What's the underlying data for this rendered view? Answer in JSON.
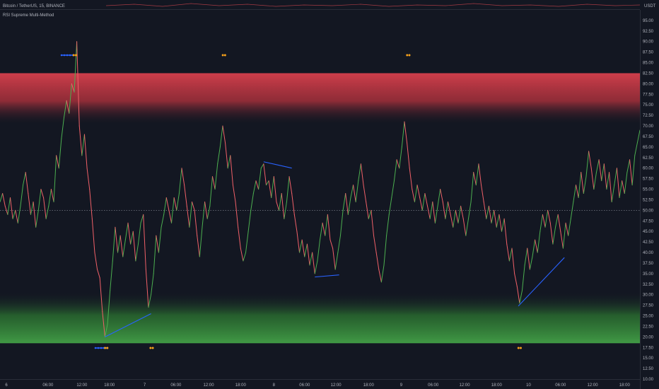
{
  "header": {
    "symbol_label": "Bitcoin / TetherUS, 15, BINANCE",
    "currency": "USDT"
  },
  "indicator": {
    "name": "RSI Supreme Multi-Method"
  },
  "colors": {
    "background": "#131722",
    "overbought_zone": "#c9434c",
    "oversold_zone": "#3a9a45",
    "divergence_line": "#2962ff",
    "signal_marker": "#f7a21b",
    "rsi_up": "#4caf50",
    "rsi_down": "#f06068"
  },
  "chart_data": {
    "type": "line",
    "title": "",
    "ylim": [
      10.0,
      97.5
    ],
    "yticks": [
      95.0,
      92.5,
      90.0,
      87.5,
      85.0,
      82.5,
      80.0,
      77.5,
      75.0,
      72.5,
      70.0,
      67.5,
      65.0,
      62.5,
      60.0,
      57.5,
      55.0,
      52.5,
      50.0,
      47.5,
      45.0,
      42.5,
      40.0,
      37.5,
      35.0,
      32.5,
      30.0,
      27.5,
      25.0,
      22.5,
      20.0,
      17.5,
      15.0,
      12.5,
      10.0
    ],
    "ytick_labels": [
      "95.00",
      "92.50",
      "90.00",
      "87.50",
      "85.00",
      "82.50",
      "80.00",
      "77.50",
      "75.00",
      "72.50",
      "70.00",
      "67.50",
      "65.00",
      "62.50",
      "60.00",
      "57.50",
      "55.00",
      "52.50",
      "50.00",
      "47.50",
      "45.00",
      "42.50",
      "40.00",
      "37.50",
      "35.00",
      "32.50",
      "30.00",
      "27.50",
      "25.00",
      "22.50",
      "20.00",
      "17.50",
      "15.00",
      "12.50",
      "10.00"
    ],
    "xlim": [
      0,
      100
    ],
    "xticks": [
      {
        "x": 1.0,
        "label": "6"
      },
      {
        "x": 7.5,
        "label": "06:00"
      },
      {
        "x": 12.8,
        "label": "12:00"
      },
      {
        "x": 17.1,
        "label": "18:00"
      },
      {
        "x": 22.6,
        "label": "7"
      },
      {
        "x": 27.5,
        "label": "06:00"
      },
      {
        "x": 32.6,
        "label": "12:00"
      },
      {
        "x": 37.6,
        "label": "18:00"
      },
      {
        "x": 42.8,
        "label": "8"
      },
      {
        "x": 47.6,
        "label": "06:00"
      },
      {
        "x": 52.5,
        "label": "12:00"
      },
      {
        "x": 57.6,
        "label": "18:00"
      },
      {
        "x": 62.7,
        "label": "9"
      },
      {
        "x": 67.7,
        "label": "06:00"
      },
      {
        "x": 72.6,
        "label": "12:00"
      },
      {
        "x": 77.6,
        "label": "18:00"
      },
      {
        "x": 82.6,
        "label": "10"
      },
      {
        "x": 87.6,
        "label": "06:00"
      },
      {
        "x": 92.6,
        "label": "12:00"
      },
      {
        "x": 97.6,
        "label": "18:00"
      }
    ],
    "overbought_band": [
      70.5,
      82.5
    ],
    "oversold_band": [
      18.5,
      30.5
    ],
    "midline": 50,
    "series": [
      {
        "points": [
          [
            0,
            52
          ],
          [
            0.4,
            54
          ],
          [
            0.8,
            51
          ],
          [
            1.2,
            49
          ],
          [
            1.6,
            53
          ],
          [
            2.0,
            48
          ],
          [
            2.4,
            50
          ],
          [
            2.8,
            47
          ],
          [
            3.2,
            51
          ],
          [
            3.6,
            56
          ],
          [
            4.0,
            59
          ],
          [
            4.4,
            54
          ],
          [
            4.8,
            49
          ],
          [
            5.2,
            52
          ],
          [
            5.6,
            46
          ],
          [
            6.0,
            50
          ],
          [
            6.4,
            55
          ],
          [
            6.8,
            53
          ],
          [
            7.2,
            48
          ],
          [
            7.6,
            51
          ],
          [
            8.0,
            55
          ],
          [
            8.4,
            52
          ],
          [
            8.8,
            63
          ],
          [
            9.2,
            60
          ],
          [
            9.6,
            67
          ],
          [
            10.0,
            72
          ],
          [
            10.4,
            76
          ],
          [
            10.8,
            73
          ],
          [
            11.2,
            80
          ],
          [
            11.6,
            78
          ],
          [
            12.0,
            90
          ],
          [
            12.4,
            70
          ],
          [
            12.8,
            63
          ],
          [
            13.2,
            68
          ],
          [
            13.6,
            60
          ],
          [
            14.0,
            55
          ],
          [
            14.4,
            48
          ],
          [
            14.8,
            40
          ],
          [
            15.2,
            36
          ],
          [
            15.6,
            34
          ],
          [
            16.0,
            26
          ],
          [
            16.4,
            20
          ],
          [
            16.8,
            23
          ],
          [
            17.2,
            31
          ],
          [
            17.6,
            38
          ],
          [
            18.0,
            46
          ],
          [
            18.4,
            40
          ],
          [
            18.8,
            44
          ],
          [
            19.2,
            39
          ],
          [
            19.6,
            43
          ],
          [
            20.0,
            47
          ],
          [
            20.4,
            42
          ],
          [
            20.8,
            45
          ],
          [
            21.2,
            38
          ],
          [
            21.6,
            42
          ],
          [
            22.0,
            47
          ],
          [
            22.4,
            49
          ],
          [
            22.8,
            36
          ],
          [
            23.2,
            27
          ],
          [
            23.6,
            30
          ],
          [
            24.0,
            35
          ],
          [
            24.4,
            44
          ],
          [
            24.8,
            40
          ],
          [
            25.2,
            46
          ],
          [
            25.6,
            49
          ],
          [
            26.0,
            53
          ],
          [
            26.4,
            50
          ],
          [
            26.8,
            47
          ],
          [
            27.2,
            53
          ],
          [
            27.6,
            50
          ],
          [
            28.0,
            54
          ],
          [
            28.4,
            60
          ],
          [
            28.8,
            56
          ],
          [
            29.2,
            51
          ],
          [
            29.6,
            46
          ],
          [
            30.0,
            52
          ],
          [
            30.4,
            50
          ],
          [
            30.8,
            44
          ],
          [
            31.2,
            39
          ],
          [
            31.6,
            46
          ],
          [
            32.0,
            52
          ],
          [
            32.4,
            48
          ],
          [
            32.8,
            51
          ],
          [
            33.2,
            58
          ],
          [
            33.6,
            55
          ],
          [
            34.0,
            61
          ],
          [
            34.4,
            65
          ],
          [
            34.8,
            70
          ],
          [
            35.2,
            66
          ],
          [
            35.6,
            60
          ],
          [
            36.0,
            63
          ],
          [
            36.4,
            56
          ],
          [
            36.8,
            52
          ],
          [
            37.2,
            46
          ],
          [
            37.6,
            41
          ],
          [
            38.0,
            38
          ],
          [
            38.4,
            40
          ],
          [
            38.8,
            45
          ],
          [
            39.2,
            50
          ],
          [
            39.6,
            54
          ],
          [
            40.0,
            57
          ],
          [
            40.4,
            55
          ],
          [
            40.8,
            60
          ],
          [
            41.2,
            61
          ],
          [
            41.6,
            56
          ],
          [
            42.0,
            57
          ],
          [
            42.4,
            53
          ],
          [
            42.8,
            58
          ],
          [
            43.2,
            52
          ],
          [
            43.6,
            50
          ],
          [
            44.0,
            54
          ],
          [
            44.4,
            48
          ],
          [
            44.8,
            52
          ],
          [
            45.2,
            58
          ],
          [
            45.6,
            54
          ],
          [
            46.0,
            49
          ],
          [
            46.4,
            45
          ],
          [
            46.8,
            40
          ],
          [
            47.2,
            43
          ],
          [
            47.6,
            39
          ],
          [
            48.0,
            42
          ],
          [
            48.4,
            37
          ],
          [
            48.8,
            40
          ],
          [
            49.2,
            35
          ],
          [
            49.6,
            38
          ],
          [
            50.0,
            43
          ],
          [
            50.4,
            47
          ],
          [
            50.8,
            44
          ],
          [
            51.2,
            49
          ],
          [
            51.6,
            43
          ],
          [
            52.0,
            41
          ],
          [
            52.4,
            36
          ],
          [
            52.8,
            40
          ],
          [
            53.2,
            44
          ],
          [
            53.6,
            50
          ],
          [
            54.0,
            54
          ],
          [
            54.4,
            49
          ],
          [
            54.8,
            53
          ],
          [
            55.2,
            56
          ],
          [
            55.6,
            52
          ],
          [
            56.0,
            57
          ],
          [
            56.4,
            61
          ],
          [
            56.8,
            56
          ],
          [
            57.2,
            52
          ],
          [
            57.6,
            48
          ],
          [
            58.0,
            50
          ],
          [
            58.4,
            44
          ],
          [
            58.8,
            40
          ],
          [
            59.2,
            36
          ],
          [
            59.6,
            33
          ],
          [
            60.0,
            37
          ],
          [
            60.4,
            44
          ],
          [
            60.8,
            49
          ],
          [
            61.2,
            53
          ],
          [
            61.6,
            57
          ],
          [
            62.0,
            62
          ],
          [
            62.4,
            60
          ],
          [
            62.8,
            65
          ],
          [
            63.2,
            71
          ],
          [
            63.6,
            66
          ],
          [
            64.0,
            60
          ],
          [
            64.4,
            55
          ],
          [
            64.8,
            52
          ],
          [
            65.2,
            56
          ],
          [
            65.6,
            53
          ],
          [
            66.0,
            50
          ],
          [
            66.4,
            54
          ],
          [
            66.8,
            51
          ],
          [
            67.2,
            48
          ],
          [
            67.6,
            52
          ],
          [
            68.0,
            47
          ],
          [
            68.4,
            51
          ],
          [
            68.8,
            55
          ],
          [
            69.2,
            52
          ],
          [
            69.6,
            48
          ],
          [
            70.0,
            52
          ],
          [
            70.4,
            49
          ],
          [
            70.8,
            46
          ],
          [
            71.2,
            50
          ],
          [
            71.6,
            47
          ],
          [
            72.0,
            51
          ],
          [
            72.4,
            48
          ],
          [
            72.8,
            44
          ],
          [
            73.2,
            48
          ],
          [
            73.6,
            52
          ],
          [
            74.0,
            59
          ],
          [
            74.4,
            56
          ],
          [
            74.8,
            61
          ],
          [
            75.2,
            56
          ],
          [
            75.6,
            52
          ],
          [
            76.0,
            48
          ],
          [
            76.4,
            51
          ],
          [
            76.8,
            47
          ],
          [
            77.2,
            50
          ],
          [
            77.6,
            46
          ],
          [
            78.0,
            49
          ],
          [
            78.4,
            45
          ],
          [
            78.8,
            48
          ],
          [
            79.2,
            42
          ],
          [
            79.6,
            38
          ],
          [
            80.0,
            41
          ],
          [
            80.4,
            35
          ],
          [
            80.8,
            32
          ],
          [
            81.2,
            28
          ],
          [
            81.6,
            31
          ],
          [
            82.0,
            37
          ],
          [
            82.4,
            41
          ],
          [
            82.8,
            36
          ],
          [
            83.2,
            39
          ],
          [
            83.6,
            43
          ],
          [
            84.0,
            40
          ],
          [
            84.4,
            45
          ],
          [
            84.8,
            49
          ],
          [
            85.2,
            46
          ],
          [
            85.6,
            50
          ],
          [
            86.0,
            47
          ],
          [
            86.4,
            42
          ],
          [
            86.8,
            46
          ],
          [
            87.2,
            49
          ],
          [
            87.6,
            45
          ],
          [
            88.0,
            41
          ],
          [
            88.4,
            47
          ],
          [
            88.8,
            44
          ],
          [
            89.2,
            48
          ],
          [
            89.6,
            52
          ],
          [
            90.0,
            56
          ],
          [
            90.4,
            53
          ],
          [
            90.8,
            59
          ],
          [
            91.2,
            54
          ],
          [
            91.6,
            58
          ],
          [
            92.0,
            64
          ],
          [
            92.4,
            60
          ],
          [
            92.8,
            55
          ],
          [
            93.2,
            59
          ],
          [
            93.6,
            62
          ],
          [
            94.0,
            57
          ],
          [
            94.4,
            61
          ],
          [
            94.8,
            55
          ],
          [
            95.2,
            59
          ],
          [
            95.6,
            52
          ],
          [
            96.0,
            56
          ],
          [
            96.4,
            60
          ],
          [
            96.8,
            53
          ],
          [
            97.2,
            57
          ],
          [
            97.6,
            54
          ],
          [
            98.0,
            59
          ],
          [
            98.4,
            62
          ],
          [
            98.8,
            56
          ],
          [
            99.2,
            63
          ],
          [
            99.6,
            66
          ],
          [
            100,
            69
          ]
        ]
      }
    ],
    "divergence_lines": [
      [
        [
          16.4,
          20.0
        ],
        [
          23.6,
          25.5
        ]
      ],
      [
        [
          41.2,
          61.5
        ],
        [
          45.6,
          60.0
        ]
      ],
      [
        [
          49.2,
          34.2
        ],
        [
          53.0,
          34.7
        ]
      ],
      [
        [
          81.0,
          27.3
        ],
        [
          88.2,
          38.8
        ]
      ]
    ],
    "top_markers": [
      {
        "x": 10.5,
        "kind": "blue"
      },
      {
        "x": 11.7,
        "kind": "orange"
      },
      {
        "x": 35.0,
        "kind": "orange"
      },
      {
        "x": 63.8,
        "kind": "orange"
      }
    ],
    "bottom_markers": [
      {
        "x": 15.8,
        "kind": "blue"
      },
      {
        "x": 16.6,
        "kind": "orange"
      },
      {
        "x": 23.7,
        "kind": "orange"
      },
      {
        "x": 81.2,
        "kind": "orange"
      }
    ]
  }
}
